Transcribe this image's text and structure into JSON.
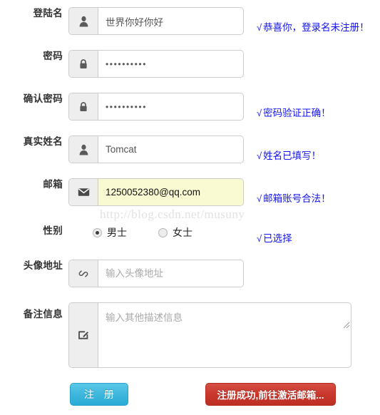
{
  "form": {
    "rows": [
      {
        "label": "登陆名",
        "icon": "user-icon",
        "value": "世界你好你好",
        "placeholder": "",
        "type": "text",
        "message": "恭喜你，登录名未注册！",
        "autofilled": false
      },
      {
        "label": "密码",
        "icon": "lock-icon",
        "value": "••••••••••",
        "placeholder": "",
        "type": "password",
        "message": "",
        "autofilled": false
      },
      {
        "label": "确认密码",
        "icon": "lock-icon",
        "value": "••••••••••",
        "placeholder": "",
        "type": "password",
        "message": "密码验证正确！",
        "autofilled": false
      },
      {
        "label": "真实姓名",
        "icon": "user-icon",
        "value": "Tomcat",
        "placeholder": "",
        "type": "text",
        "message": "姓名已填写！",
        "autofilled": false
      },
      {
        "label": "邮箱",
        "icon": "envelope-icon",
        "value": "1250052380@qq.com",
        "placeholder": "",
        "type": "text",
        "message": "邮箱账号合法！",
        "autofilled": true
      }
    ],
    "gender": {
      "label": "性别",
      "options": [
        {
          "label": "男士",
          "checked": true
        },
        {
          "label": "女士",
          "checked": false
        }
      ],
      "message": "已选择"
    },
    "avatar": {
      "label": "头像地址",
      "icon": "link-icon",
      "value": "",
      "placeholder": "输入头像地址"
    },
    "remark": {
      "label": "备注信息",
      "icon": "edit-icon",
      "value": "",
      "placeholder": "输入其他描述信息"
    },
    "tick_glyph": "√"
  },
  "buttons": {
    "register": "注 册",
    "status": "注册成功,前往激活邮箱...",
    "register_color": "#41b8dd",
    "status_color": "#c9372c"
  },
  "watermark": {
    "text": "http://blog.csdn.net/musuny"
  },
  "colors": {
    "message": "#1414f0",
    "label": "#333333",
    "addon_bg": "#eeeeee",
    "border": "#cccccc",
    "autofill_bg": "#fafad2"
  }
}
